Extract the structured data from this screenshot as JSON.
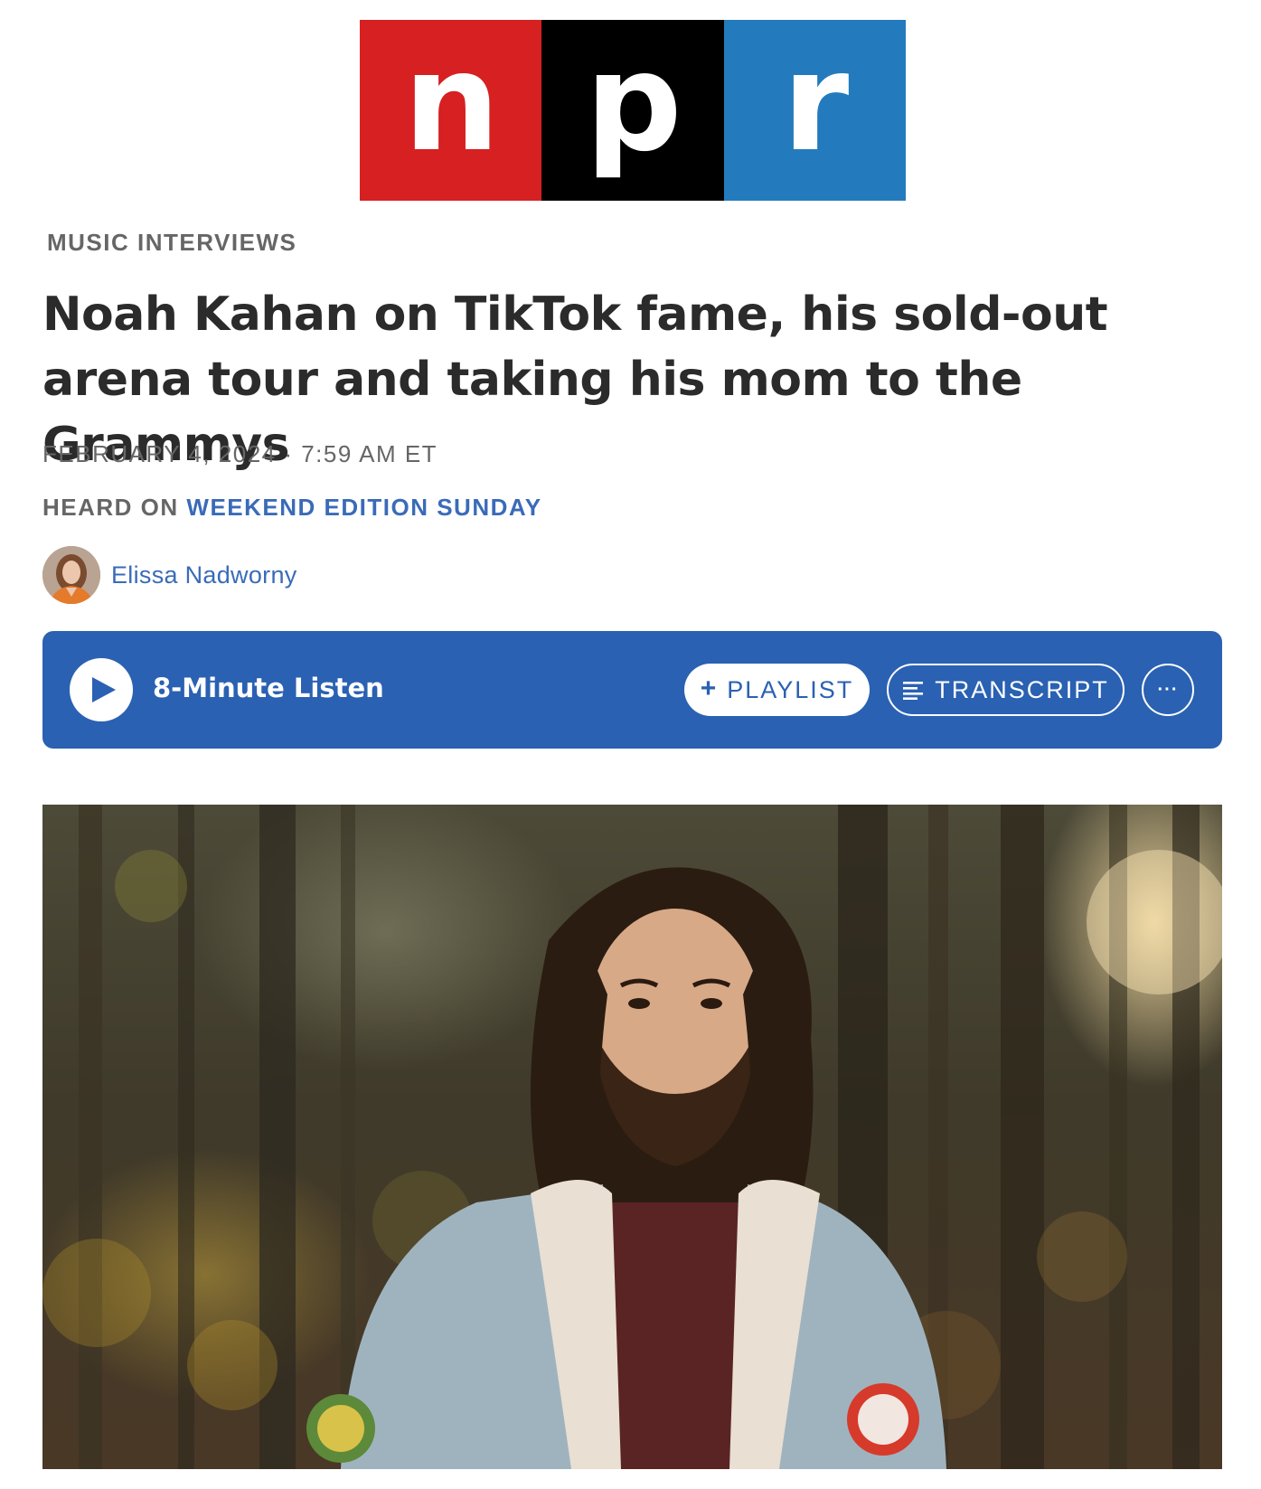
{
  "logo": {
    "letters": [
      "n",
      "p",
      "r"
    ],
    "colors": [
      "#d62021",
      "#000000",
      "#237bbd"
    ]
  },
  "article": {
    "section": "MUSIC INTERVIEWS",
    "headline": "Noah Kahan on TikTok fame, his sold-out arena tour and taking his mom to the Grammys",
    "date": "FEBRUARY 4, 2024 · 7:59 AM ET",
    "heard_on_prefix": "HEARD ON ",
    "heard_on_show": "WEEKEND EDITION SUNDAY",
    "author": "Elissa Nadworny"
  },
  "player": {
    "listen_label": "8-Minute Listen",
    "playlist_label": "PLAYLIST",
    "transcript_label": "TRANSCRIPT",
    "more_label": "···",
    "accent": "#2a61b2"
  },
  "icons": {
    "play": "play-icon",
    "plus": "plus-icon",
    "transcript": "transcript-lines-icon",
    "more": "more-dots-icon"
  },
  "colors": {
    "link": "#3a6bb8",
    "meta_text": "#666666",
    "headline_text": "#2b2b2b"
  }
}
